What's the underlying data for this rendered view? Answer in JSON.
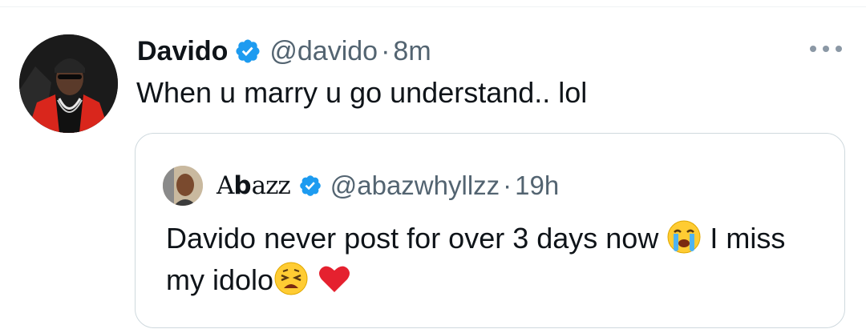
{
  "tweet": {
    "author_name": "Davido",
    "handle": "@davido",
    "separator": "·",
    "time": "8m",
    "text": "When u marry u go understand.. lol",
    "verified": true
  },
  "quoted_tweet": {
    "author_name_prefix": "A",
    "author_name_bold": "b",
    "author_name_suffix": "azz",
    "handle": "@abazwhyllzz",
    "separator": "·",
    "time": "19h",
    "text_part1": "Davido never post for over 3 days now",
    "text_part2": " I miss my idolo",
    "verified": true
  },
  "colors": {
    "verified_badge": "#1d9bf0",
    "secondary_text": "#536471",
    "border": "#cfd9de"
  },
  "icons": {
    "verified": "verified-badge-icon",
    "more": "more-icon",
    "emoji_1": "loudly-crying-face-emoji",
    "emoji_2": "weary-face-emoji",
    "emoji_3": "red-heart-emoji"
  }
}
